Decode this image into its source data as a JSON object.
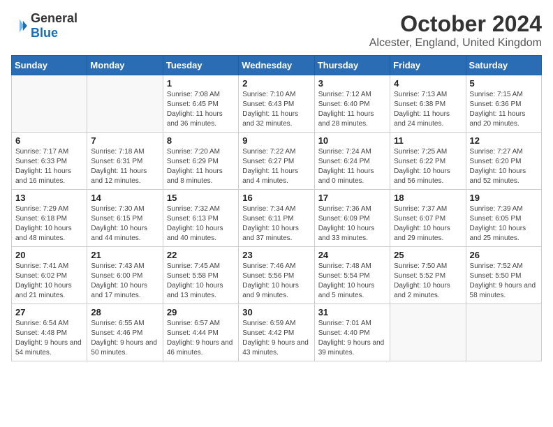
{
  "logo": {
    "general": "General",
    "blue": "Blue"
  },
  "title": "October 2024",
  "location": "Alcester, England, United Kingdom",
  "weekdays": [
    "Sunday",
    "Monday",
    "Tuesday",
    "Wednesday",
    "Thursday",
    "Friday",
    "Saturday"
  ],
  "weeks": [
    [
      {
        "day": "",
        "empty": true
      },
      {
        "day": "",
        "empty": true
      },
      {
        "day": "1",
        "sunrise": "7:08 AM",
        "sunset": "6:45 PM",
        "daylight": "11 hours and 36 minutes."
      },
      {
        "day": "2",
        "sunrise": "7:10 AM",
        "sunset": "6:43 PM",
        "daylight": "11 hours and 32 minutes."
      },
      {
        "day": "3",
        "sunrise": "7:12 AM",
        "sunset": "6:40 PM",
        "daylight": "11 hours and 28 minutes."
      },
      {
        "day": "4",
        "sunrise": "7:13 AM",
        "sunset": "6:38 PM",
        "daylight": "11 hours and 24 minutes."
      },
      {
        "day": "5",
        "sunrise": "7:15 AM",
        "sunset": "6:36 PM",
        "daylight": "11 hours and 20 minutes."
      }
    ],
    [
      {
        "day": "6",
        "sunrise": "7:17 AM",
        "sunset": "6:33 PM",
        "daylight": "11 hours and 16 minutes."
      },
      {
        "day": "7",
        "sunrise": "7:18 AM",
        "sunset": "6:31 PM",
        "daylight": "11 hours and 12 minutes."
      },
      {
        "day": "8",
        "sunrise": "7:20 AM",
        "sunset": "6:29 PM",
        "daylight": "11 hours and 8 minutes."
      },
      {
        "day": "9",
        "sunrise": "7:22 AM",
        "sunset": "6:27 PM",
        "daylight": "11 hours and 4 minutes."
      },
      {
        "day": "10",
        "sunrise": "7:24 AM",
        "sunset": "6:24 PM",
        "daylight": "11 hours and 0 minutes."
      },
      {
        "day": "11",
        "sunrise": "7:25 AM",
        "sunset": "6:22 PM",
        "daylight": "10 hours and 56 minutes."
      },
      {
        "day": "12",
        "sunrise": "7:27 AM",
        "sunset": "6:20 PM",
        "daylight": "10 hours and 52 minutes."
      }
    ],
    [
      {
        "day": "13",
        "sunrise": "7:29 AM",
        "sunset": "6:18 PM",
        "daylight": "10 hours and 48 minutes."
      },
      {
        "day": "14",
        "sunrise": "7:30 AM",
        "sunset": "6:15 PM",
        "daylight": "10 hours and 44 minutes."
      },
      {
        "day": "15",
        "sunrise": "7:32 AM",
        "sunset": "6:13 PM",
        "daylight": "10 hours and 40 minutes."
      },
      {
        "day": "16",
        "sunrise": "7:34 AM",
        "sunset": "6:11 PM",
        "daylight": "10 hours and 37 minutes."
      },
      {
        "day": "17",
        "sunrise": "7:36 AM",
        "sunset": "6:09 PM",
        "daylight": "10 hours and 33 minutes."
      },
      {
        "day": "18",
        "sunrise": "7:37 AM",
        "sunset": "6:07 PM",
        "daylight": "10 hours and 29 minutes."
      },
      {
        "day": "19",
        "sunrise": "7:39 AM",
        "sunset": "6:05 PM",
        "daylight": "10 hours and 25 minutes."
      }
    ],
    [
      {
        "day": "20",
        "sunrise": "7:41 AM",
        "sunset": "6:02 PM",
        "daylight": "10 hours and 21 minutes."
      },
      {
        "day": "21",
        "sunrise": "7:43 AM",
        "sunset": "6:00 PM",
        "daylight": "10 hours and 17 minutes."
      },
      {
        "day": "22",
        "sunrise": "7:45 AM",
        "sunset": "5:58 PM",
        "daylight": "10 hours and 13 minutes."
      },
      {
        "day": "23",
        "sunrise": "7:46 AM",
        "sunset": "5:56 PM",
        "daylight": "10 hours and 9 minutes."
      },
      {
        "day": "24",
        "sunrise": "7:48 AM",
        "sunset": "5:54 PM",
        "daylight": "10 hours and 5 minutes."
      },
      {
        "day": "25",
        "sunrise": "7:50 AM",
        "sunset": "5:52 PM",
        "daylight": "10 hours and 2 minutes."
      },
      {
        "day": "26",
        "sunrise": "7:52 AM",
        "sunset": "5:50 PM",
        "daylight": "9 hours and 58 minutes."
      }
    ],
    [
      {
        "day": "27",
        "sunrise": "6:54 AM",
        "sunset": "4:48 PM",
        "daylight": "9 hours and 54 minutes."
      },
      {
        "day": "28",
        "sunrise": "6:55 AM",
        "sunset": "4:46 PM",
        "daylight": "9 hours and 50 minutes."
      },
      {
        "day": "29",
        "sunrise": "6:57 AM",
        "sunset": "4:44 PM",
        "daylight": "9 hours and 46 minutes."
      },
      {
        "day": "30",
        "sunrise": "6:59 AM",
        "sunset": "4:42 PM",
        "daylight": "9 hours and 43 minutes."
      },
      {
        "day": "31",
        "sunrise": "7:01 AM",
        "sunset": "4:40 PM",
        "daylight": "9 hours and 39 minutes."
      },
      {
        "day": "",
        "empty": true
      },
      {
        "day": "",
        "empty": true
      }
    ]
  ],
  "labels": {
    "sunrise": "Sunrise:",
    "sunset": "Sunset:",
    "daylight": "Daylight:"
  }
}
